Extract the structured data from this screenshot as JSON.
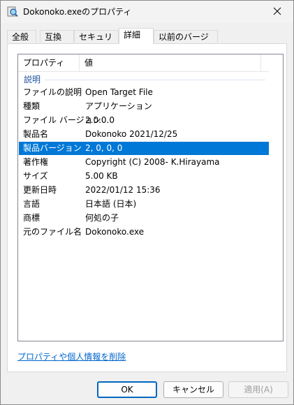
{
  "window": {
    "title": "Dokonoko.exeのプロパティ"
  },
  "tabs": [
    {
      "label": "全般"
    },
    {
      "label": "互換性"
    },
    {
      "label": "セキュリティ"
    },
    {
      "label": "詳細"
    },
    {
      "label": "以前のバージョン"
    }
  ],
  "details": {
    "header_property": "プロパティ",
    "header_value": "値",
    "group_label": "説明",
    "rows": [
      {
        "key": "ファイルの説明",
        "value": "Open Target File"
      },
      {
        "key": "種類",
        "value": "アプリケーション"
      },
      {
        "key": "ファイル バージョン",
        "value": "2.0.0.0"
      },
      {
        "key": "製品名",
        "value": "Dokonoko 2021/12/25"
      },
      {
        "key": "製品バージョン",
        "value": "2, 0, 0, 0"
      },
      {
        "key": "著作権",
        "value": "Copyright (C) 2008- K.Hirayama"
      },
      {
        "key": "サイズ",
        "value": "5.00 KB"
      },
      {
        "key": "更新日時",
        "value": "2022/01/12 15:36"
      },
      {
        "key": "言語",
        "value": "日本語 (日本)"
      },
      {
        "key": "商標",
        "value": "何処の子"
      },
      {
        "key": "元のファイル名",
        "value": "Dokonoko.exe"
      }
    ],
    "selected_row": "製品バージョン"
  },
  "remove_link": "プロパティや個人情報を削除",
  "buttons": {
    "ok": "OK",
    "cancel": "キャンセル",
    "apply": "適用(A)"
  },
  "colors": {
    "selection": "#0078d7",
    "link": "#0066cc",
    "group": "#1e50a0"
  }
}
